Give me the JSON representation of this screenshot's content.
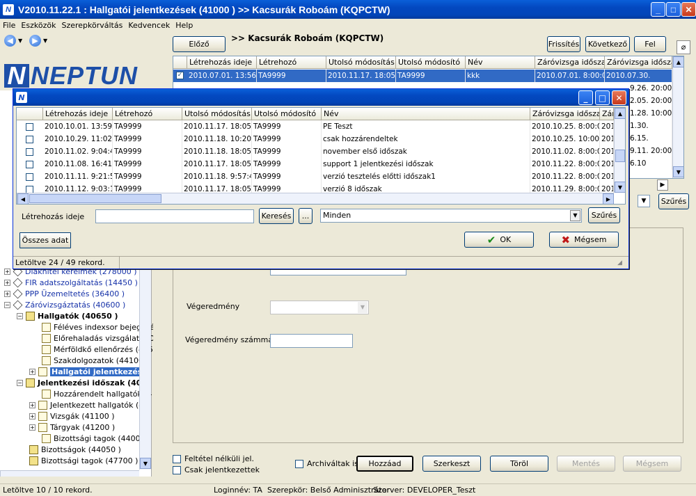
{
  "window": {
    "title": "V2010.11.22.1 : Hallgatói jelentkezések (41000  )  >> Kacsurák Roboám (KQPCTW)"
  },
  "menu": [
    "File",
    "Eszközök",
    "Szerepkörváltás",
    "Kedvencek",
    "Help"
  ],
  "logo": {
    "text": "NEPTUN"
  },
  "tree": [
    {
      "label": "Diákhitel kérelmek (278000 )",
      "color": "blue"
    },
    {
      "label": "FIR adatszolgáltatás (14450  )",
      "color": "blue"
    },
    {
      "label": "PPP Üzemeltetés (36400  )",
      "color": "blue"
    },
    {
      "label": "Záróvizsgáztatás (40600  )",
      "color": "blue"
    },
    {
      "label": "Hallgatók (40650  )",
      "bold": true
    },
    {
      "label": "Féléves indexsor bejegyzé"
    },
    {
      "label": "Előrehaladás vizsgálat (40"
    },
    {
      "label": "Mérföldkő ellenőrzés (405"
    },
    {
      "label": "Szakdolgozatok (44100  )"
    },
    {
      "label": "Hallgatói jelentkezése",
      "selected": true
    },
    {
      "label": "Jelentkezési időszak (40",
      "bold": true
    },
    {
      "label": "Hozzárendelt hallgatók (4"
    },
    {
      "label": "Jelentkezett hallgatók (41"
    },
    {
      "label": "Vizsgák (41100  )"
    },
    {
      "label": "Tárgyak (41200  )"
    },
    {
      "label": "Bizottsági tagok (44000  )"
    },
    {
      "label": "Bizottságok (44050  )"
    },
    {
      "label": "Bizottsági tagok (47700  )"
    }
  ],
  "main": {
    "prev_button": "Előző",
    "heading": ">> Kacsurák Roboám (KQPCTW)",
    "refresh_button": "Frissítés",
    "next_button": "Következő",
    "up_button": "Fel",
    "grid_headers": [
      "Létrehozás ideje",
      "Létrehozó",
      "Utolsó módosítás ...",
      "Utolsó módosító",
      "Név",
      "Záróvizsga idősza...",
      "Záróvizsga idősza..."
    ],
    "grid_row": [
      "2010.07.01. 13:56:1",
      "TA9999",
      "2010.11.17. 18:05:5",
      "TA9999",
      "kkk",
      "2010.07.01. 8:00:00",
      "2010.07.30."
    ],
    "grid_right_col": [
      "9.26. 20:00:0",
      "2.05. 20:00:0",
      "1.28. 10:00:0",
      "1.30.",
      "6.15.",
      "9.11. 20:00:0",
      "6.10"
    ],
    "filter_button": "Szűrés",
    "vegeredmeny_label": "Végeredmény",
    "vegeredmeny_szam_label": "Végeredmény számmal",
    "feltetel_label": "Feltétel nélküli jel.",
    "csak_label": "Csak jelentkezettek",
    "archivaltak_label": "Archiváltak is",
    "add_button": "Hozzáad",
    "edit_button": "Szerkeszt",
    "delete_button": "Töröl",
    "save_button": "Mentés",
    "cancel_button": "Mégsem"
  },
  "dialog": {
    "headers": [
      "Létrehozás ideje",
      "Létrehozó",
      "Utolsó módosítás ...",
      "Utolsó módosító",
      "Név",
      "Záróvizsga idősza...",
      "Zár"
    ],
    "rows": [
      [
        "2010.10.01. 13:59:4",
        "TA9999",
        "2010.11.17. 18:05:5",
        "TA9999",
        "PE Teszt",
        "2010.10.25. 8:00:00",
        "201"
      ],
      [
        "2010.10.29. 11:02:1",
        "TA9999",
        "2010.11.18. 10:20:5",
        "TA9999",
        "csak hozzárendeltek",
        "2010.10.25. 10:00:0",
        "201"
      ],
      [
        "2010.11.02. 9:04:40",
        "TA9999",
        "2010.11.18. 18:05:5",
        "TA9999",
        "november első időszak",
        "2010.11.02. 8:00:00",
        "201"
      ],
      [
        "2010.11.08. 16:41:0",
        "TA9999",
        "2010.11.17. 18:05:5",
        "TA9999",
        "support 1 jelentkezési időszak",
        "2010.11.22. 8:00:00",
        "201"
      ],
      [
        "2010.11.11. 9:21:53",
        "TA9999",
        "2010.11.18. 9:57:43",
        "TA9999",
        "verzió tesztelés előtti időszak1",
        "2010.11.22. 8:00:00",
        "201"
      ],
      [
        "2010.11.12. 9:03:15",
        "TA9999",
        "2010.11.17. 18:05:5",
        "TA9999",
        "verzió 8 időszak",
        "2010.11.29. 8:00:00",
        "201"
      ]
    ],
    "filter_label": "Létrehozás ideje",
    "search_button": "Keresés",
    "dots_button": "...",
    "select_value": "Minden",
    "filter_button": "Szűrés",
    "all_data_button": "Összes adat",
    "ok_button": "OK",
    "cancel_button": "Mégsem",
    "status": "Letöltve 24 / 49 rekord."
  },
  "statusbar": {
    "left": "Letöltve 10 / 10 rekord.",
    "login": "Loginnév: TA",
    "role": "Szerepkör: Belső Adminisztrátor",
    "server": "Szerver: DEVELOPER_Teszt"
  }
}
